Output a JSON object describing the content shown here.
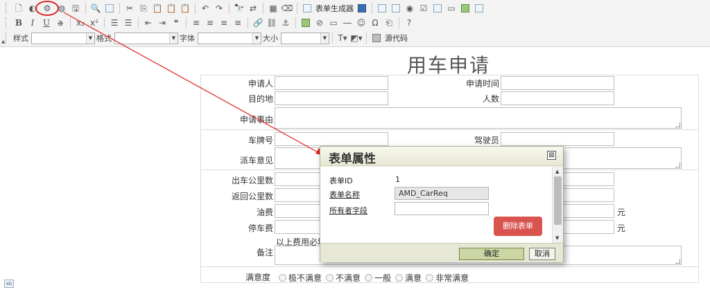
{
  "toolbar": {
    "form_generator_label": "表单生成器",
    "source_label": "源代码",
    "style_label": "样式",
    "format_label": "格式",
    "font_label": "字体",
    "size_label": "大小"
  },
  "form": {
    "title": "用车申请",
    "fields": {
      "applicant": "申请人",
      "apply_time": "申请时间",
      "destination": "目的地",
      "people_count": "人数",
      "reason": "申请事由",
      "plate_no": "车牌号",
      "driver": "驾驶员",
      "dispatch_opinion": "派车意见",
      "start_mileage": "出车公里数",
      "return_mileage": "返回公里数",
      "fuel_cost": "油费",
      "parking_fee": "停车费",
      "remarks": "备注",
      "satisfaction": "满意度"
    },
    "unit": "元",
    "note_prefix": "以上费用必填",
    "satisfaction_options": [
      "极不满意",
      "不满意",
      "一般",
      "满意",
      "非常满意"
    ]
  },
  "dialog": {
    "title": "表单属性",
    "close_glyph": "⊠",
    "form_id_label": "表单ID",
    "form_id_value": "1",
    "form_name_label": "表单名称",
    "form_name_value": "AMD_CarReq",
    "owner_field_label": "所有者字段",
    "owner_field_value": "",
    "delete_label": "删除表单",
    "ok_label": "确定",
    "cancel_label": "取消"
  },
  "colors": {
    "annotation_red": "#e02020",
    "delete_button": "#d9534f",
    "ok_button": "#cbd6a4"
  }
}
